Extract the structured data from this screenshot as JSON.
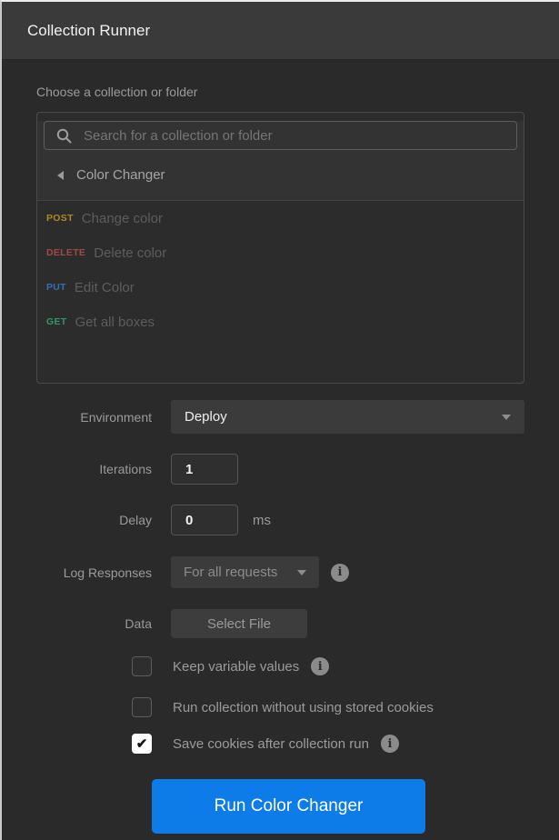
{
  "header": {
    "title": "Collection Runner"
  },
  "picker": {
    "label": "Choose a collection or folder",
    "search_placeholder": "Search for a collection or folder",
    "collection": {
      "name": "Color Changer"
    },
    "requests": [
      {
        "method": "POST",
        "name": "Change color",
        "color": "#ad8a28"
      },
      {
        "method": "DELETE",
        "name": "Delete color",
        "color": "#a14b46"
      },
      {
        "method": "PUT",
        "name": "Edit Color",
        "color": "#3a6db1"
      },
      {
        "method": "GET",
        "name": "Get all boxes",
        "color": "#37946a"
      }
    ]
  },
  "form": {
    "environment": {
      "label": "Environment",
      "value": "Deploy"
    },
    "iterations": {
      "label": "Iterations",
      "value": "1"
    },
    "delay": {
      "label": "Delay",
      "value": "0",
      "unit": "ms"
    },
    "log_responses": {
      "label": "Log Responses",
      "value": "For all requests"
    },
    "data": {
      "label": "Data",
      "button_label": "Select File"
    },
    "checkboxes": [
      {
        "label": "Keep variable values",
        "checked": false
      },
      {
        "label": "Run collection without using stored cookies",
        "checked": false
      },
      {
        "label": "Save cookies after collection run",
        "checked": true
      }
    ]
  },
  "icons": {
    "info_glyph": "i",
    "check_glyph": "✔"
  },
  "run": {
    "label": "Run Color Changer",
    "background": "#0d7ce8"
  }
}
